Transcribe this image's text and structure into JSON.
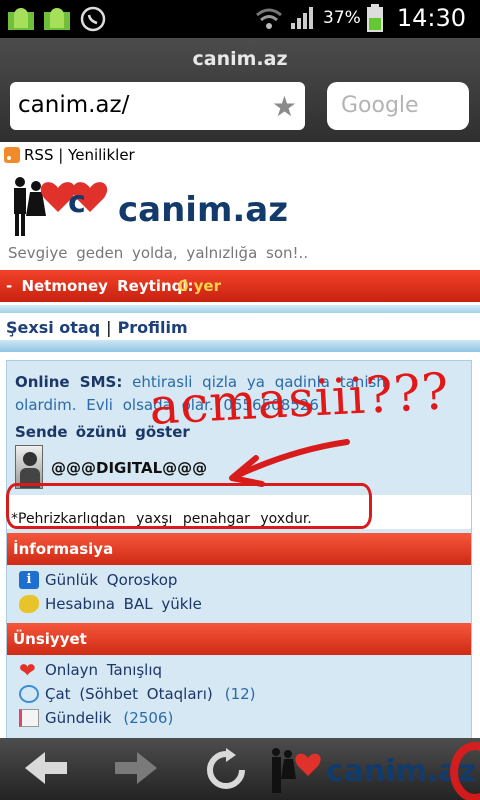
{
  "status_bar": {
    "battery_percent": "37%",
    "time": "14:30",
    "icons": [
      "android-debug-icon",
      "android-usb-icon",
      "whatsapp-icon",
      "wifi-icon",
      "signal-icon",
      "battery-icon"
    ]
  },
  "browser": {
    "title": "canim.az",
    "url": "canim.az/",
    "search_placeholder": "Google"
  },
  "page": {
    "rss_label": "RSS | Yenilikler",
    "logo_text": "canim.az",
    "slogan": "Sevgiye  geden yolda,  yalnızlığa  son!..",
    "netmoney_label": "- Netmoney  Reytinqi:",
    "netmoney_value": "0 yer",
    "nav": {
      "personal_room": "Şexsi  otaq",
      "separator": "|",
      "profile": "Profilim"
    },
    "online_sms": {
      "label": "Online  SMS:",
      "text": "ehtirasli  qizla  ya qadinla  tanish  olardim.  Evli  olsada  olar.  0556508526"
    },
    "show_yourself_label": "Sende  özünü  göster",
    "featured_user": "@@@DIGITAL@@@",
    "diet_notice": "*Pehrizkarlıqdan    yaxşı  penahgar  yoxdur.",
    "sections": [
      {
        "title": "İnformasiya",
        "items": [
          {
            "label": "Günlük  Qoroskop",
            "count": ""
          },
          {
            "label": "Hesabına  BAL  yükle",
            "count": ""
          }
        ]
      },
      {
        "title": "Ünsiyyet",
        "items": [
          {
            "label": "Onlayn  Tanışlıq",
            "count": ""
          },
          {
            "label": "Çat  (Söhbet  Otaqları)",
            "count": "(12)"
          },
          {
            "label": "Gündelik",
            "count": "(2506)"
          }
        ]
      }
    ]
  },
  "annotation": {
    "text": "acmasiii???",
    "color": "#e01818"
  },
  "colors": {
    "brand_red": "#d42a16",
    "link_blue": "#1b3767",
    "panel_bg": "#d6e8f4"
  }
}
